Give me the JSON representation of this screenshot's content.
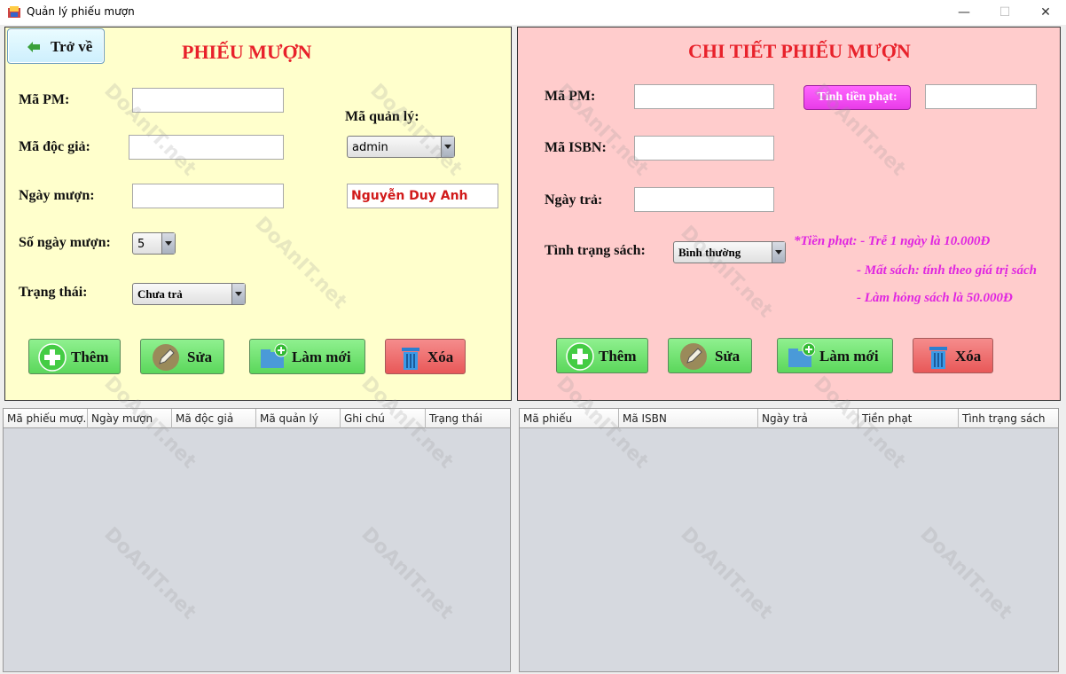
{
  "window": {
    "title": "Quản lý phiếu mượn",
    "controls": {
      "minimize": "—",
      "maximize": "☐",
      "close": "✕"
    }
  },
  "left_panel": {
    "back_button": "Trở về",
    "title": "PHIẾU MƯỢN",
    "labels": {
      "ma_pm": "Mã PM:",
      "ma_doc_gia": "Mã độc giả:",
      "ngay_muon": "Ngày mượn:",
      "so_ngay_muon": "Số ngày mượn:",
      "trang_thai": "Trạng thái:",
      "ma_quan_ly": "Mã quản lý:"
    },
    "values": {
      "ma_pm": "",
      "ma_doc_gia": "",
      "ngay_muon": "",
      "so_ngay_muon": "5",
      "trang_thai": "Chưa trả",
      "ma_quan_ly": "admin",
      "ten_quan_ly": "Nguyễn Duy Anh"
    },
    "buttons": {
      "add": "Thêm",
      "edit": "Sửa",
      "refresh": "Làm mới",
      "delete": "Xóa"
    }
  },
  "right_panel": {
    "title": "CHI TIẾT PHIẾU MƯỢN",
    "labels": {
      "ma_pm": "Mã PM:",
      "ma_isbn": "Mã ISBN:",
      "ngay_tra": "Ngày trả:",
      "tinh_trang_sach": "Tình trạng sách:"
    },
    "values": {
      "ma_pm": "",
      "ma_isbn": "",
      "ngay_tra": "",
      "tien_phat": "",
      "tinh_trang_sach": "Bình thường"
    },
    "calc_fine_button": "Tính tiền phạt:",
    "notes": [
      "*Tiền phạt:  - Trễ 1 ngày là 10.000Đ",
      "- Mất sách: tính theo giá trị sách",
      "- Làm hỏng sách là 50.000Đ"
    ],
    "buttons": {
      "add": "Thêm",
      "edit": "Sửa",
      "refresh": "Làm mới",
      "delete": "Xóa"
    }
  },
  "left_table": {
    "columns": [
      "Mã phiếu mượ...",
      "Ngày mượn",
      "Mã độc giả",
      "Mã quản lý",
      "Ghi chú",
      "Trạng thái"
    ],
    "rows": []
  },
  "right_table": {
    "columns": [
      "Mã phiếu",
      "Mã ISBN",
      "Ngày trả",
      "Tiền phạt",
      "Tình trạng sách"
    ],
    "rows": []
  },
  "watermark": "DoAnIT.net",
  "colors": {
    "left_bg": "#ffffcc",
    "right_bg": "#ffcccc",
    "title_red": "#e8222b",
    "note_magenta": "#e026e0",
    "button_green": "#66dd66",
    "button_red": "#ee6666"
  }
}
